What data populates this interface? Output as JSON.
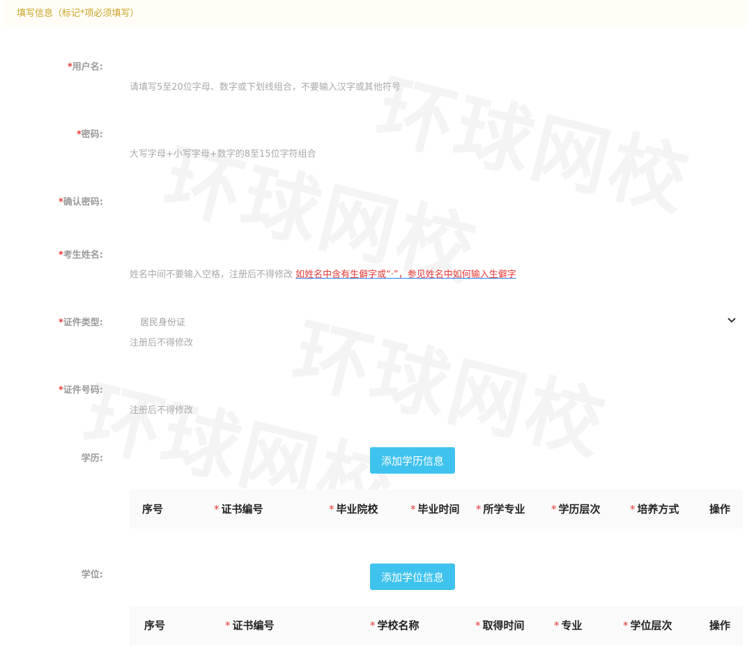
{
  "notice": {
    "text": "填写信息（标记*项必须填写）"
  },
  "watermark": {
    "text": "环球网校"
  },
  "form": {
    "username": {
      "required": "*",
      "label": "用户名:",
      "hint": "请填写5至20位字母、数字或下划线组合，不要输入汉字或其他符号",
      "value": ""
    },
    "password": {
      "required": "*",
      "label": "密码:",
      "hint": "大写字母+小写字母+数字的8至15位字符组合",
      "value": ""
    },
    "confirm_password": {
      "required": "*",
      "label": "确认密码:",
      "value": ""
    },
    "name": {
      "required": "*",
      "label": "考生姓名:",
      "hint": "姓名中间不要输入空格，注册后不得修改",
      "link": "如姓名中含有生僻字或“·”，参见姓名中如何输入生僻字",
      "value": ""
    },
    "id_type": {
      "required": "*",
      "label": "证件类型:",
      "value": "居民身份证",
      "hint": "注册后不得修改"
    },
    "id_number": {
      "required": "*",
      "label": "证件号码:",
      "hint": "注册后不得修改",
      "value": ""
    },
    "education": {
      "label": "学历:",
      "add_button": "添加学历信息"
    },
    "degree": {
      "label": "学位:",
      "add_button": "添加学位信息"
    }
  },
  "education_table": {
    "required_mark": "*",
    "columns": [
      {
        "label": "序号",
        "required": false
      },
      {
        "label": "证书编号",
        "required": true
      },
      {
        "label": "毕业院校",
        "required": true
      },
      {
        "label": "毕业时间",
        "required": true
      },
      {
        "label": "所学专业",
        "required": true
      },
      {
        "label": "学历层次",
        "required": true
      },
      {
        "label": "培养方式",
        "required": true
      },
      {
        "label": "操作",
        "required": false
      }
    ]
  },
  "degree_table": {
    "required_mark": "*",
    "columns": [
      {
        "label": "序号",
        "required": false
      },
      {
        "label": "证书编号",
        "required": true
      },
      {
        "label": "学校名称",
        "required": true
      },
      {
        "label": "取得时间",
        "required": true
      },
      {
        "label": "专业",
        "required": true
      },
      {
        "label": "学位层次",
        "required": true
      },
      {
        "label": "操作",
        "required": false
      }
    ]
  },
  "colors": {
    "accent": "#3fc3ee",
    "required": "#e53935",
    "notice": "#c9a227"
  },
  "icons": {
    "select_arrow": "chevron-down-icon"
  }
}
